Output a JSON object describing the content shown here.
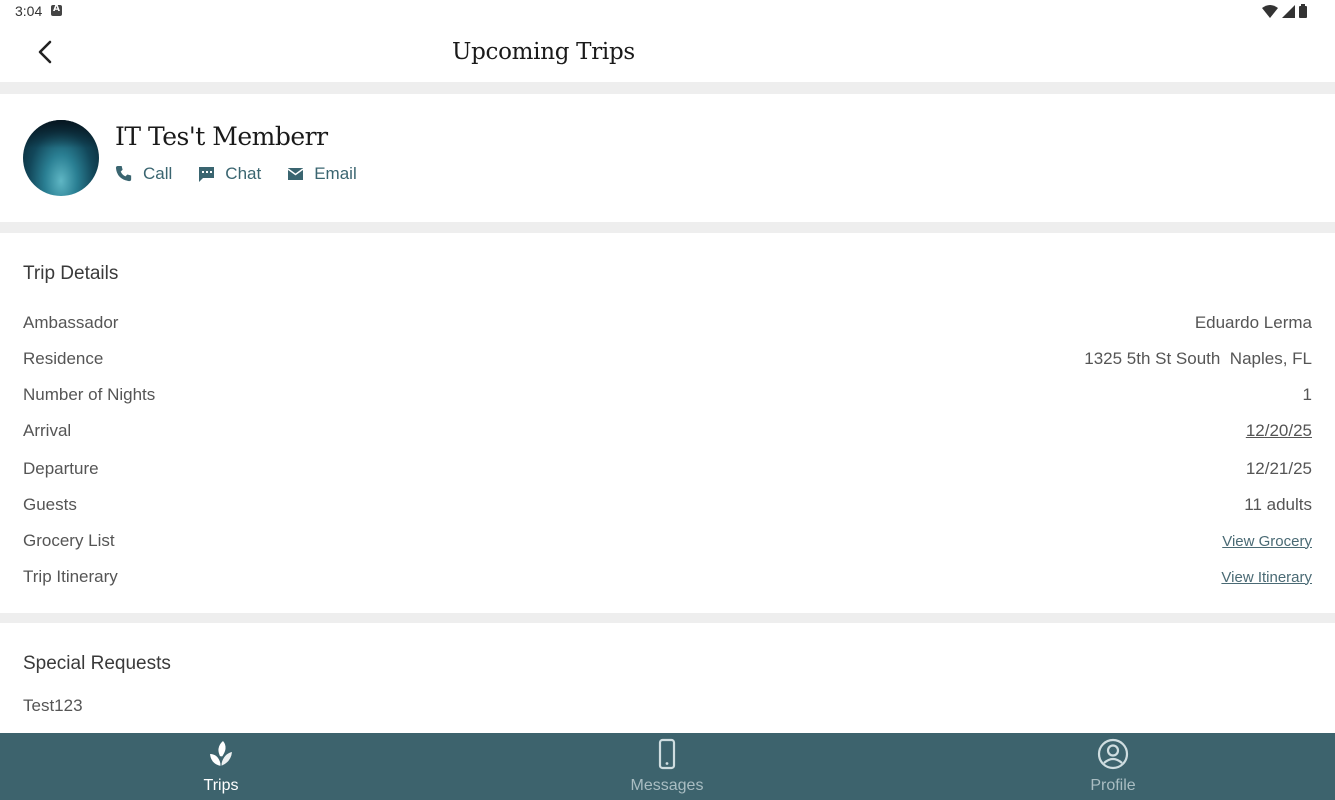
{
  "status_bar": {
    "time": "3:04"
  },
  "app_bar": {
    "title": "Upcoming Trips"
  },
  "member": {
    "name": "IT Tes't Memberr",
    "contacts": {
      "call": "Call",
      "chat": "Chat",
      "email": "Email"
    }
  },
  "trip_details": {
    "title": "Trip Details",
    "rows": [
      {
        "label": "Ambassador",
        "value": "Eduardo Lerma"
      },
      {
        "label": "Residence",
        "value": "1325 5th St South  Naples, FL"
      },
      {
        "label": "Number of Nights",
        "value": "1"
      },
      {
        "label": "Arrival",
        "value": "12/20/25"
      },
      {
        "label": "Departure",
        "value": "12/21/25"
      },
      {
        "label": "Guests",
        "value": "11 adults"
      },
      {
        "label": "Grocery List",
        "value": "View Grocery"
      },
      {
        "label": "Trip Itinerary",
        "value": "View Itinerary"
      }
    ]
  },
  "special_requests": {
    "title": "Special Requests",
    "text": "Test123"
  },
  "bottom_nav": {
    "items": [
      {
        "label": "Trips",
        "icon": "leaf-logo-icon",
        "active": true
      },
      {
        "label": "Messages",
        "icon": "phone-icon",
        "active": false
      },
      {
        "label": "Profile",
        "icon": "profile-icon",
        "active": false
      }
    ]
  },
  "colors": {
    "nav_background": "#3d636d",
    "accent": "#3a6570",
    "divider": "#eeeeee"
  }
}
